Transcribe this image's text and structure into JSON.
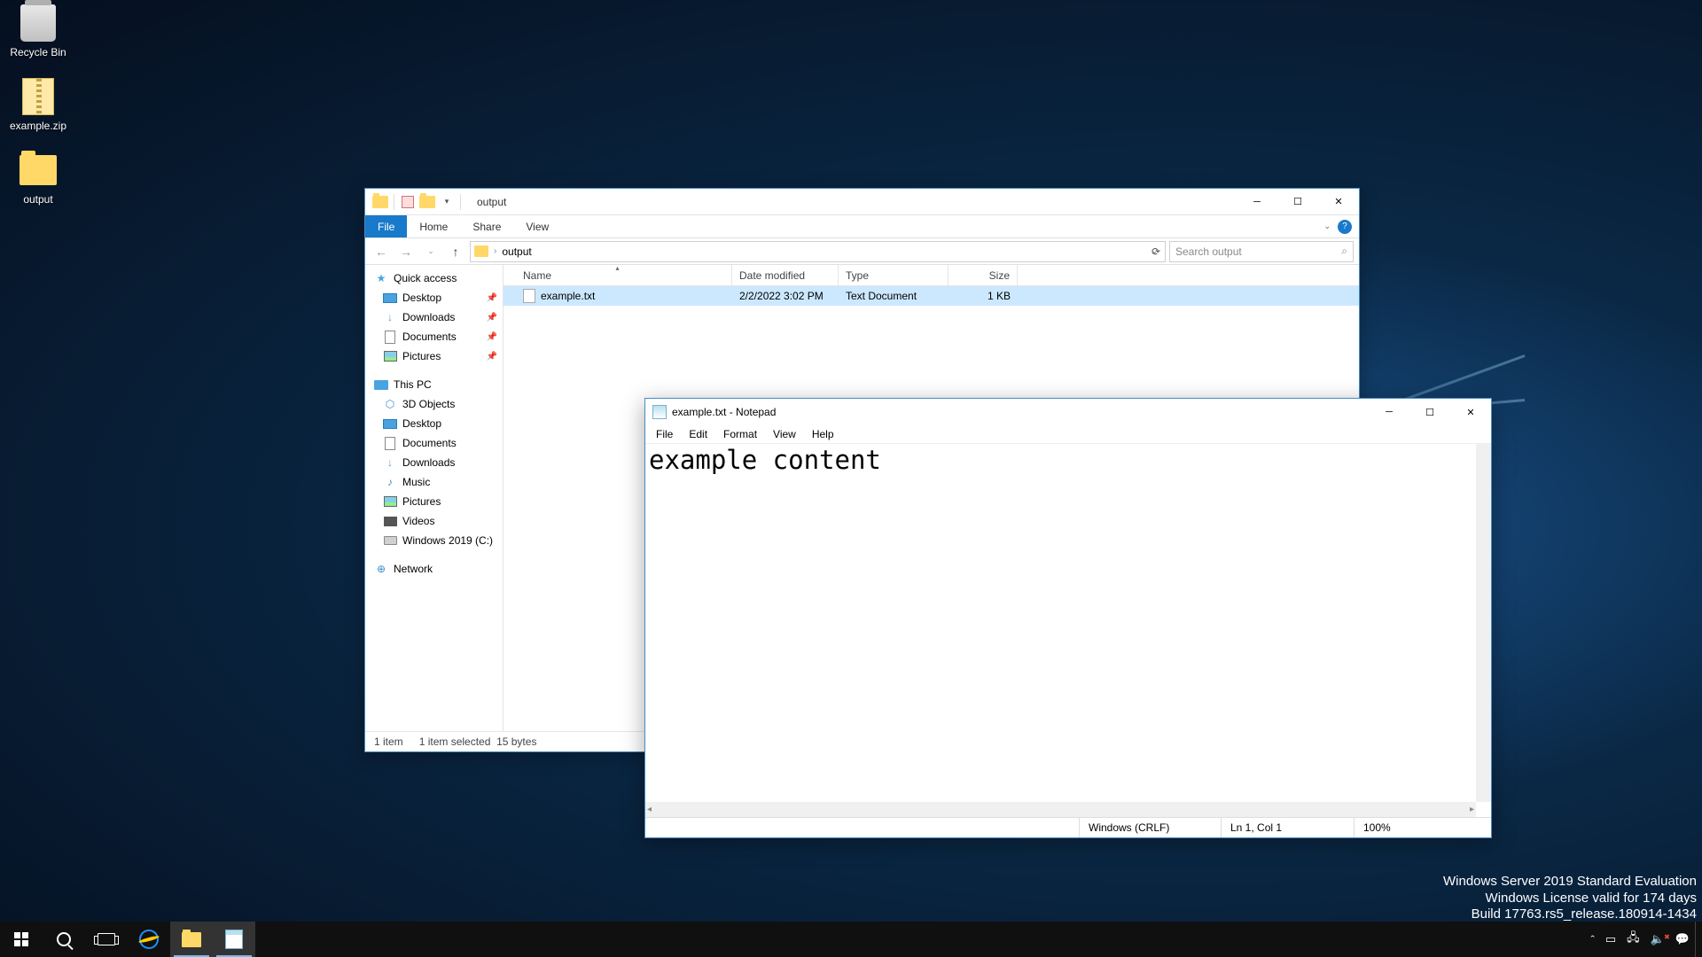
{
  "desktop": {
    "icons": [
      {
        "label": "Recycle Bin",
        "type": "recycle"
      },
      {
        "label": "example.zip",
        "type": "zip"
      },
      {
        "label": "output",
        "type": "folder"
      }
    ]
  },
  "watermark": {
    "line1": "Windows Server 2019 Standard Evaluation",
    "line2": "Windows License valid for 174 days",
    "line3": "Build 17763.rs5_release.180914-1434"
  },
  "explorer": {
    "title": "output",
    "ribbon": {
      "file": "File",
      "home": "Home",
      "share": "Share",
      "view": "View"
    },
    "breadcrumb": {
      "path": "output"
    },
    "search": {
      "placeholder": "Search output"
    },
    "columns": {
      "name": "Name",
      "date": "Date modified",
      "type": "Type",
      "size": "Size"
    },
    "files": [
      {
        "name": "example.txt",
        "date": "2/2/2022 3:02 PM",
        "type": "Text Document",
        "size": "1 KB"
      }
    ],
    "nav": {
      "quick_access": "Quick access",
      "quick_items": [
        "Desktop",
        "Downloads",
        "Documents",
        "Pictures"
      ],
      "this_pc": "This PC",
      "pc_items": [
        "3D Objects",
        "Desktop",
        "Documents",
        "Downloads",
        "Music",
        "Pictures",
        "Videos",
        "Windows 2019 (C:)"
      ],
      "network": "Network"
    },
    "status": {
      "count": "1 item",
      "selected": "1 item selected",
      "bytes": "15 bytes"
    }
  },
  "notepad": {
    "title": "example.txt - Notepad",
    "menu": {
      "file": "File",
      "edit": "Edit",
      "format": "Format",
      "view": "View",
      "help": "Help"
    },
    "content": "example content",
    "status": {
      "encoding": "Windows (CRLF)",
      "position": "Ln 1, Col 1",
      "zoom": "100%"
    }
  },
  "taskbar": {}
}
